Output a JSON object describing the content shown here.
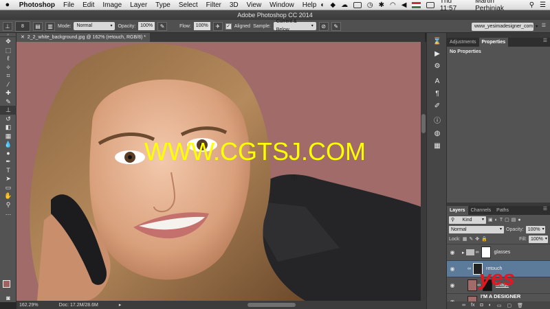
{
  "menubar": {
    "apple_icon": "apple-logo-icon",
    "app": "Photoshop",
    "items": [
      "File",
      "Edit",
      "Image",
      "Layer",
      "Type",
      "Select",
      "Filter",
      "3D",
      "View",
      "Window",
      "Help"
    ],
    "clock": "Thu 11:57",
    "user": "Martin Perhiniak"
  },
  "window_title": "Adobe Photoshop CC 2014",
  "options_bar": {
    "brush_size": "8",
    "mode_label": "Mode:",
    "mode_value": "Normal",
    "opacity_label": "Opacity:",
    "opacity_value": "100%",
    "flow_label": "Flow:",
    "flow_value": "100%",
    "aligned_label": "Aligned",
    "sample_label": "Sample:",
    "sample_value": "Current & Below",
    "workspace": "www_yesimadesigner_com"
  },
  "document": {
    "tab_title": "2_2_white_background.jpg @ 162% (retouch, RGB/8) *",
    "watermark": "WWW.CGTSJ.COM",
    "zoom": "162.29%",
    "doc_size": "Doc: 17.2M/28.6M"
  },
  "swatches": {
    "foreground": "#a0625e",
    "background": "#ffffff"
  },
  "adjustments_panel": {
    "tabs": [
      "Adjustments",
      "Properties"
    ],
    "active_tab": "Properties",
    "body": "No Properties"
  },
  "layers_panel": {
    "tabs": [
      "Layers",
      "Channels",
      "Paths"
    ],
    "filter_value": "Kind",
    "blend_mode": "Normal",
    "opacity_label": "Opacity:",
    "opacity_value": "100%",
    "lock_label": "Lock:",
    "fill_label": "Fill:",
    "fill_value": "100%",
    "layers": [
      {
        "name": "glasses",
        "selected": false
      },
      {
        "name": "retouch",
        "selected": true
      },
      {
        "name": "image",
        "selected": false
      },
      {
        "name": "",
        "selected": false
      }
    ]
  },
  "logo": {
    "big": "yes",
    "small": "I'M A DESIGNER"
  }
}
